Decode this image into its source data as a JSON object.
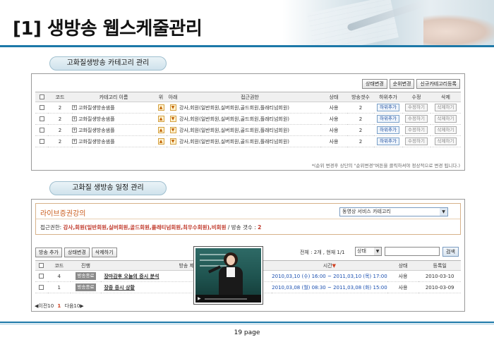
{
  "page_title": "[1] 생방송 웹스케줄관리",
  "section1": {
    "label": "고화질생방송 카테고리 관리",
    "buttons": {
      "status_change": "상태변경",
      "order_change": "순위변경",
      "new_category": "신규카테고리등록"
    },
    "headers": [
      "코드",
      "카테고리 이름",
      "위",
      "아래",
      "접근권한",
      "상태",
      "방송갯수",
      "하위추가",
      "수정",
      "삭제"
    ],
    "rows": [
      {
        "code": "2",
        "name": "고화질생방송샘플",
        "access": "강사,회원(일반회원,실버회원,골드회원,플래티넘회원)",
        "status": "사용",
        "count": "2",
        "add": "하위추가",
        "edit": "수정하기",
        "delete": "삭제하기"
      },
      {
        "code": "2",
        "name": "고화질생방송샘플",
        "access": "강사,회원(일반회원,실버회원,골드회원,플래티넘회원)",
        "status": "사용",
        "count": "2",
        "add": "하위추가",
        "edit": "수정하기",
        "delete": "삭제하기"
      },
      {
        "code": "2",
        "name": "고화질생방송샘플",
        "access": "강사,회원(일반회원,실버회원,골드회원,플래티넘회원)",
        "status": "사용",
        "count": "2",
        "add": "하위추가",
        "edit": "수정하기",
        "delete": "삭제하기"
      },
      {
        "code": "2",
        "name": "고화질생방송샘플",
        "access": "강사,회원(일반회원,실버회원,골드회원,플래티넘회원)",
        "status": "사용",
        "count": "2",
        "add": "하위추가",
        "edit": "수정하기",
        "delete": "삭제하기"
      }
    ],
    "note": "*(순위 변경후 상단의 \"순위변경\"버튼을 클릭하셔야 정상적으로 변경 됩니다.)"
  },
  "section2": {
    "label": "고화질 생방송 일정 관리",
    "channel_title": "라이브증권강의",
    "category_select": "동영상 서비스 카테고리",
    "access_label": "접근권한:",
    "access_value": "강사,회원(일반회원,실버회원,골드회원,플래티넘회원,최우수회원),비회원",
    "count_label": "/ 방송 갯수 :",
    "count_value": "2",
    "buttons": {
      "add": "방송 추가",
      "status": "상태변경",
      "delete": "삭제하기",
      "search": "검색"
    },
    "summary": "전체 : 2개 , 현재 1/1",
    "status_select": "상태",
    "headers": [
      "코드",
      "진행",
      "방송 제",
      "시간",
      "상태",
      "등록일"
    ],
    "rows": [
      {
        "code": "4",
        "progress": "방송종료",
        "title": "장마감후 오늘의 증시 분석",
        "time": "2010,03,10 (수) 16:00 ~ 2011,03,10 (목) 17:00",
        "status": "사용",
        "date": "2010-03-10"
      },
      {
        "code": "1",
        "progress": "방송종료",
        "title": "장중 증시 상황",
        "time": "2010,03,08 (월) 08:30 ~ 2011,03,08 (화) 15:00",
        "status": "사용",
        "date": "2010-03-09"
      }
    ],
    "pager": {
      "prev": "◀이전10",
      "current": "1",
      "next": "다음10▶"
    }
  },
  "page_number": "19 page",
  "colors": {
    "accent": "#1c78a8",
    "brand_red": "#c0392b",
    "link_blue": "#1a4fb0"
  }
}
